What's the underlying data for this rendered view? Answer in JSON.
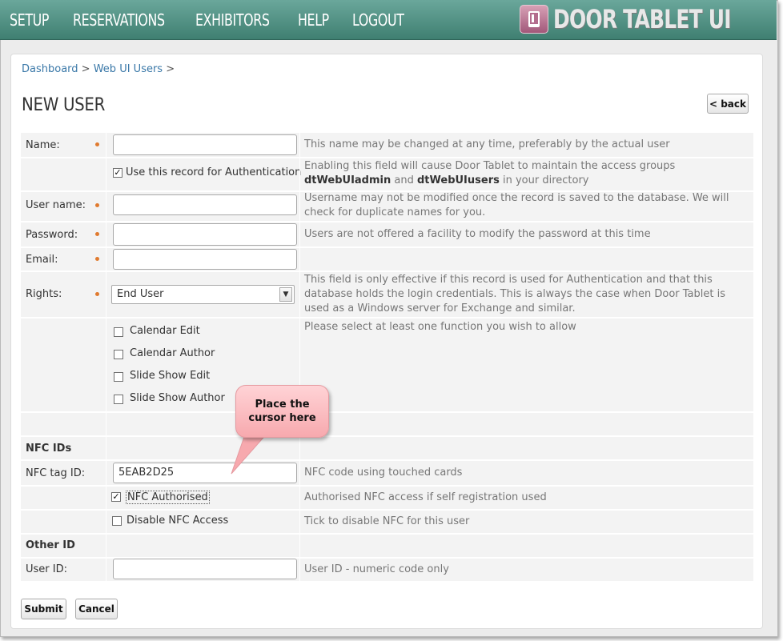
{
  "nav": {
    "items": [
      "SETUP",
      "RESERVATIONS",
      "EXHIBITORS",
      "HELP",
      "LOGOUT"
    ],
    "brand": "DOOR TABLET UI"
  },
  "breadcrumb": {
    "dashboard": "Dashboard",
    "sep1": ">",
    "web_ui_users": "Web UI Users",
    "sep2": ">"
  },
  "page_title": "NEW USER",
  "back_button": "< back",
  "form": {
    "name": {
      "label": "Name:",
      "value": "",
      "help": "This name may be changed at any time, preferably by the actual user"
    },
    "auth": {
      "checkbox_label": "Use this record for Authentication",
      "checked": true,
      "help_pre": "Enabling this field will cause Door Tablet to maintain the access groups ",
      "help_b1": "dtWebUIadmin",
      "help_and": " and ",
      "help_b2": "dtWebUIusers",
      "help_post": " in your directory"
    },
    "username": {
      "label": "User name:",
      "value": "",
      "help": "Username may not be modified once the record is saved to the database.  We will check for duplicate names for you."
    },
    "password": {
      "label": "Password:",
      "value": "",
      "help": "Users are not offered a facility to modify the password at this time"
    },
    "email": {
      "label": "Email:",
      "value": ""
    },
    "rights": {
      "label": "Rights:",
      "selected": "End User",
      "help": "This field is only effective if this record is used for Authentication and that this database holds the login credentials.  This is always the case when Door Tablet is used as a Windows server for Exchange and similar."
    },
    "functions": {
      "items": [
        "Calendar Edit",
        "Calendar Author",
        "Slide Show Edit",
        "Slide Show Author"
      ],
      "help": "Please select at least one function you wish to allow"
    },
    "nfc_section": "NFC IDs",
    "nfc_tag": {
      "label": "NFC tag ID:",
      "value": "5EAB2D25",
      "help": "NFC code using touched cards"
    },
    "nfc_authorised": {
      "label": "NFC Authorised",
      "checked": true,
      "help": "Authorised NFC access if self registration used"
    },
    "nfc_disable": {
      "label": "Disable NFC Access",
      "checked": false,
      "help": "Tick to disable NFC for this user"
    },
    "other_section": "Other ID",
    "user_id": {
      "label": "User ID:",
      "value": "",
      "help": "User ID - numeric code only"
    }
  },
  "buttons": {
    "submit": "Submit",
    "cancel": "Cancel"
  },
  "callout": {
    "line1": "Place the",
    "line2": "cursor here"
  },
  "colors": {
    "header": "#4f8f81",
    "link": "#3a78a8",
    "required_dot": "#e07a2f",
    "callout": "#f7a9ae"
  }
}
